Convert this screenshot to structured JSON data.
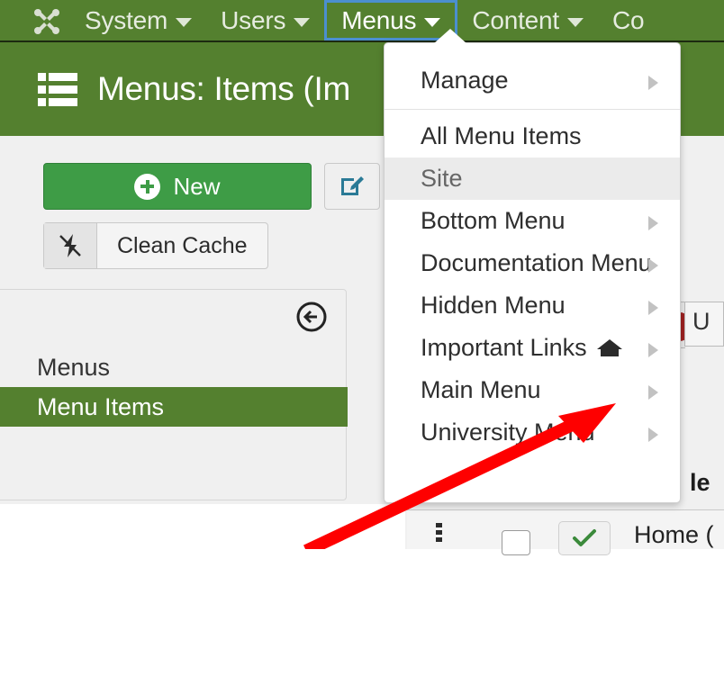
{
  "topnav": {
    "logo_icon": "joomla-logo-icon",
    "items": [
      {
        "label": "System",
        "has_caret": true,
        "active": false
      },
      {
        "label": "Users",
        "has_caret": true,
        "active": false
      },
      {
        "label": "Menus",
        "has_caret": true,
        "active": true
      },
      {
        "label": "Content",
        "has_caret": true,
        "active": false
      },
      {
        "label": "Co",
        "has_caret": false,
        "active": false
      }
    ]
  },
  "page_header": {
    "icon": "list-view-icon",
    "title": "Menus: Items (Im"
  },
  "toolbar": {
    "new_label": "New",
    "new_icon": "plus-circle-icon",
    "edit_icon": "edit-pencil-square-icon",
    "clean_cache_label": "Clean Cache",
    "clean_cache_icon": "bolt-slash-icon"
  },
  "sidebar": {
    "collapse_icon": "circle-arrow-left-icon",
    "items": [
      {
        "label": "Menus",
        "active": false
      },
      {
        "label": "Menu Items",
        "active": true
      }
    ]
  },
  "dropdown": {
    "groups": [
      {
        "items": [
          {
            "label": "Manage",
            "caret": true,
            "muted": false,
            "home": false
          }
        ]
      },
      {
        "items": [
          {
            "label": "All Menu Items",
            "caret": false,
            "muted": false,
            "home": false
          },
          {
            "label": "Site",
            "caret": false,
            "muted": true,
            "home": false
          },
          {
            "label": "Bottom Menu",
            "caret": true,
            "muted": false,
            "home": false
          },
          {
            "label": "Documentation Menu",
            "caret": true,
            "muted": false,
            "home": false
          },
          {
            "label": "Hidden Menu",
            "caret": true,
            "muted": false,
            "home": false
          },
          {
            "label": "Important Links",
            "caret": true,
            "muted": false,
            "home": true
          },
          {
            "label": "Main Menu",
            "caret": true,
            "muted": false,
            "home": false
          },
          {
            "label": "University Menu",
            "caret": true,
            "muted": false,
            "home": false
          }
        ]
      }
    ]
  },
  "table": {
    "column_header_partial": "le",
    "row": {
      "drag_handle_icon": "drag-handle-icon",
      "checkbox_icon": "row-checkbox",
      "status_icon": "check-published-icon",
      "title": "Home ("
    },
    "right_cell_text": "U"
  },
  "annotation": {
    "arrow_color": "#fe0000",
    "points_at": "Important Links"
  },
  "colors": {
    "brand_green": "#54802f",
    "new_button_green": "#3e9c46",
    "focus_blue": "#4b8fd0",
    "arrow_red": "#fe0000",
    "status_check_green": "#3b8a3b",
    "red_badge": "#9e2121"
  }
}
